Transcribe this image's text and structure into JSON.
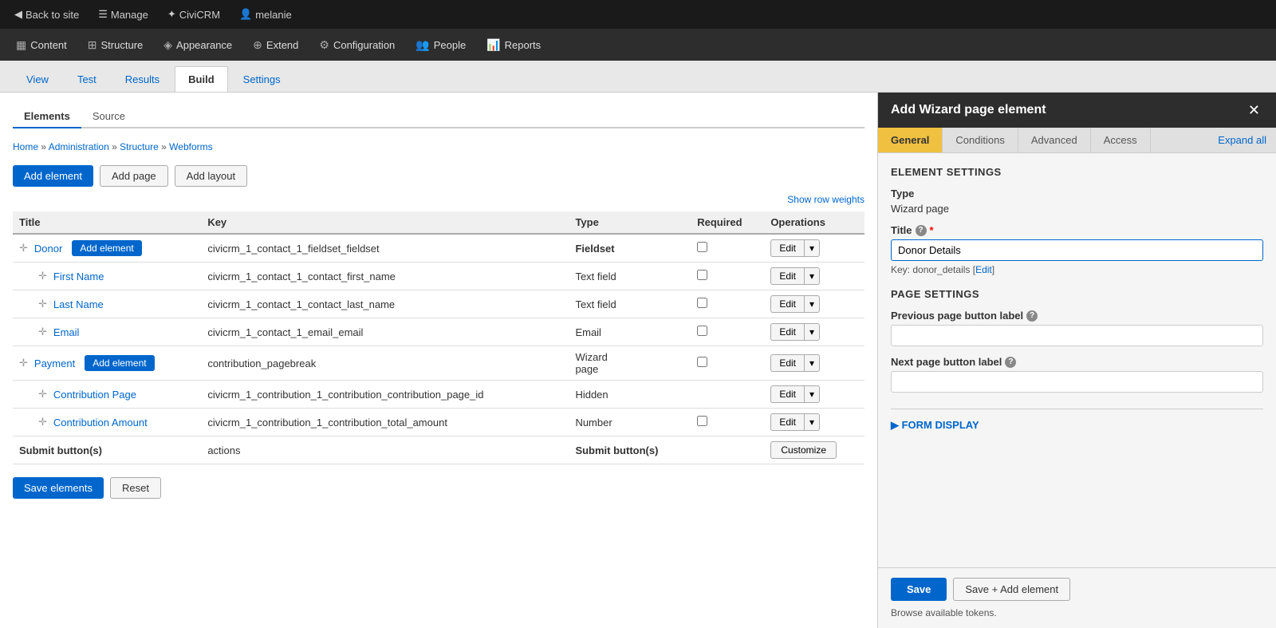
{
  "topNav": {
    "items": [
      {
        "id": "back-to-site",
        "label": "Back to site",
        "icon": "◀"
      },
      {
        "id": "manage",
        "label": "Manage",
        "icon": "☰"
      },
      {
        "id": "civicrm",
        "label": "CiviCRM",
        "icon": "✦"
      },
      {
        "id": "user",
        "label": "melanie",
        "icon": "👤"
      }
    ]
  },
  "adminBar": {
    "items": [
      {
        "id": "content",
        "label": "Content",
        "icon": "▦"
      },
      {
        "id": "structure",
        "label": "Structure",
        "icon": "⊞"
      },
      {
        "id": "appearance",
        "label": "Appearance",
        "icon": "◈"
      },
      {
        "id": "extend",
        "label": "Extend",
        "icon": "⊕"
      },
      {
        "id": "configuration",
        "label": "Configuration",
        "icon": "⚙"
      },
      {
        "id": "people",
        "label": "People",
        "icon": "👥"
      },
      {
        "id": "reports",
        "label": "Reports",
        "icon": "📊"
      }
    ]
  },
  "pageTabs": [
    {
      "id": "view",
      "label": "View",
      "active": false
    },
    {
      "id": "test",
      "label": "Test",
      "active": false
    },
    {
      "id": "results",
      "label": "Results",
      "active": false
    },
    {
      "id": "build",
      "label": "Build",
      "active": true
    },
    {
      "id": "settings",
      "label": "Settings",
      "active": false
    }
  ],
  "subTabs": [
    {
      "id": "elements",
      "label": "Elements",
      "active": true
    },
    {
      "id": "source",
      "label": "Source",
      "active": false
    }
  ],
  "breadcrumb": [
    {
      "label": "Home",
      "href": "#"
    },
    {
      "label": "Administration",
      "href": "#"
    },
    {
      "label": "Structure",
      "href": "#"
    },
    {
      "label": "Webforms",
      "href": "#"
    }
  ],
  "actionButtons": {
    "addElement": "Add element",
    "addPage": "Add page",
    "addLayout": "Add layout"
  },
  "showRowWeights": "Show row weights",
  "tableHeaders": {
    "title": "Title",
    "key": "Key",
    "type": "Type",
    "required": "Required",
    "operations": "Operations"
  },
  "tableRows": [
    {
      "id": "donor",
      "title": "Donor",
      "key": "civicrm_1_contact_1_fieldset_fieldset",
      "type": "Fieldset",
      "typeBold": true,
      "required": false,
      "hasAddBtn": true,
      "indent": 0
    },
    {
      "id": "first-name",
      "title": "First Name",
      "key": "civicrm_1_contact_1_contact_first_name",
      "type": "Text field",
      "typeBold": false,
      "required": false,
      "hasAddBtn": false,
      "indent": 1
    },
    {
      "id": "last-name",
      "title": "Last Name",
      "key": "civicrm_1_contact_1_contact_last_name",
      "type": "Text field",
      "typeBold": false,
      "required": false,
      "hasAddBtn": false,
      "indent": 1
    },
    {
      "id": "email",
      "title": "Email",
      "key": "civicrm_1_contact_1_email_email",
      "type": "Email",
      "typeBold": false,
      "required": false,
      "hasAddBtn": false,
      "indent": 1
    },
    {
      "id": "payment",
      "title": "Payment",
      "key": "contribution_pagebreak",
      "type": "Wizard page",
      "typeBold": false,
      "required": false,
      "hasAddBtn": true,
      "indent": 0
    },
    {
      "id": "contribution-page",
      "title": "Contribution Page",
      "key": "civicrm_1_contribution_1_contribution_contribution_page_id",
      "type": "Hidden",
      "typeBold": false,
      "required": false,
      "hasAddBtn": false,
      "indent": 1
    },
    {
      "id": "contribution-amount",
      "title": "Contribution Amount",
      "key": "civicrm_1_contribution_1_contribution_total_amount",
      "type": "Number",
      "typeBold": false,
      "required": false,
      "hasAddBtn": false,
      "indent": 1
    }
  ],
  "submitRow": {
    "title": "Submit button(s)",
    "key": "actions",
    "type": "Submit button(s)",
    "operation": "Customize"
  },
  "footerButtons": {
    "saveElements": "Save elements",
    "reset": "Reset"
  },
  "rightPanel": {
    "title": "Add Wizard page element",
    "tabs": [
      {
        "id": "general",
        "label": "General",
        "active": true
      },
      {
        "id": "conditions",
        "label": "Conditions",
        "active": false
      },
      {
        "id": "advanced",
        "label": "Advanced",
        "active": false
      },
      {
        "id": "access",
        "label": "Access",
        "active": false
      },
      {
        "id": "expand-all",
        "label": "Expand all",
        "active": false
      }
    ],
    "elementSettings": {
      "sectionTitle": "ELEMENT SETTINGS",
      "typeLabel": "Type",
      "typeValue": "Wizard page",
      "titleLabel": "Title",
      "titleValue": "Donor Details",
      "keyText": "Key: donor_details",
      "keyEditLabel": "Edit"
    },
    "pageSettings": {
      "sectionTitle": "PAGE SETTINGS",
      "prevPageLabel": "Previous page button label",
      "prevHelpIcon": "?",
      "nextPageLabel": "Next page button label",
      "nextHelpIcon": "?"
    },
    "formDisplay": {
      "title": "▶ FORM DISPLAY"
    },
    "footer": {
      "saveLabel": "Save",
      "saveAddLabel": "Save + Add element",
      "browseTokens": "Browse available tokens."
    }
  }
}
